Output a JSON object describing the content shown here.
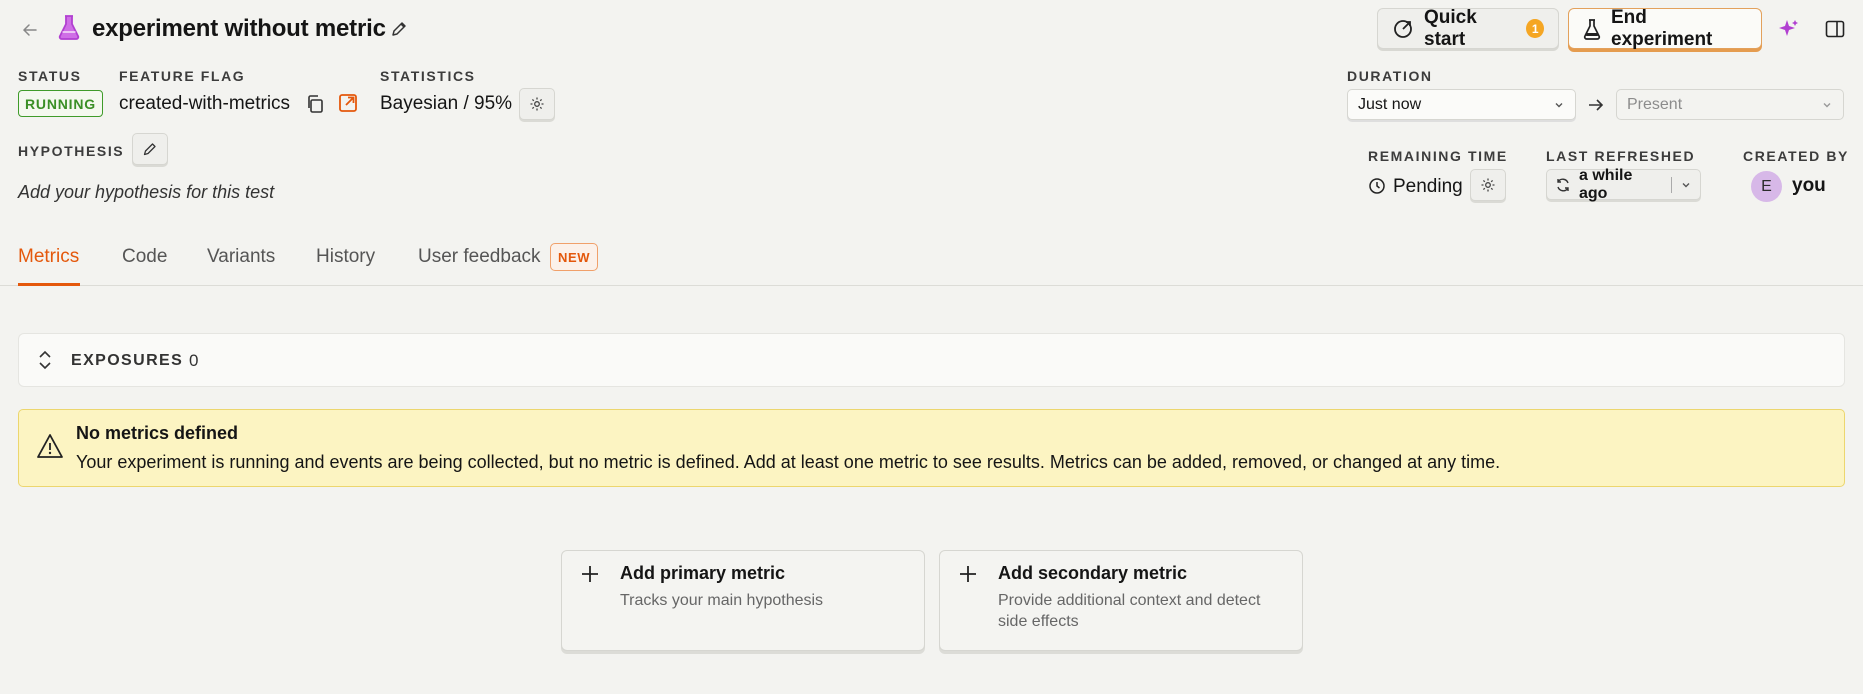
{
  "header": {
    "title": "experiment without metric",
    "quick_start_label": "Quick start",
    "quick_start_badge": "1",
    "end_experiment_label": "End experiment"
  },
  "meta": {
    "status_label": "STATUS",
    "status_value": "RUNNING",
    "feature_flag_label": "FEATURE FLAG",
    "feature_flag_value": "created-with-metrics",
    "statistics_label": "STATISTICS",
    "statistics_value": "Bayesian / 95%",
    "hypothesis_label": "HYPOTHESIS",
    "hypothesis_placeholder": "Add your hypothesis for this test",
    "duration_label": "DURATION",
    "duration_from": "Just now",
    "duration_to": "Present",
    "remaining_time_label": "REMAINING TIME",
    "remaining_time_value": "Pending",
    "last_refreshed_label": "LAST REFRESHED",
    "last_refreshed_value": "a while ago",
    "created_by_label": "CREATED BY",
    "creator_initial": "E",
    "creator_name": "you"
  },
  "tabs": [
    {
      "label": "Metrics",
      "active": true
    },
    {
      "label": "Code"
    },
    {
      "label": "Variants"
    },
    {
      "label": "History"
    },
    {
      "label": "User feedback",
      "badge": "NEW"
    }
  ],
  "exposures": {
    "label": "EXPOSURES",
    "count": "0"
  },
  "warning": {
    "title": "No metrics defined",
    "text": "Your experiment is running and events are being collected, but no metric is defined. Add at least one metric to see results. Metrics can be added, removed, or changed at any time."
  },
  "cards": {
    "primary_title": "Add primary metric",
    "primary_desc": "Tracks your main hypothesis",
    "secondary_title": "Add secondary metric",
    "secondary_desc_line1": "Provide additional context and detect",
    "secondary_desc_line2": "side effects"
  },
  "colors": {
    "accent": "#e4580c",
    "status_green": "#3a8f26",
    "warning_bg": "#fcf4c2",
    "flask_purple": "#b13fd1",
    "badge_orange": "#f5a623"
  },
  "icons": [
    "back-arrow-icon",
    "flask-icon",
    "pencil-icon",
    "rocket-icon",
    "sparkle-icon",
    "sidebar-toggle-icon",
    "copy-icon",
    "external-link-icon",
    "gear-icon",
    "arrow-right-icon",
    "clock-icon",
    "refresh-icon",
    "chevron-down-icon",
    "expand-collapse-icon",
    "warning-icon",
    "plus-icon"
  ]
}
